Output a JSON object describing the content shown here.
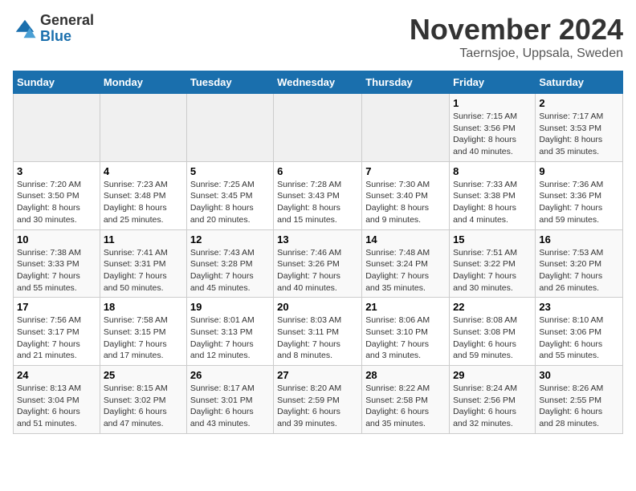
{
  "logo": {
    "general": "General",
    "blue": "Blue"
  },
  "title": "November 2024",
  "subtitle": "Taernsjoe, Uppsala, Sweden",
  "days_of_week": [
    "Sunday",
    "Monday",
    "Tuesday",
    "Wednesday",
    "Thursday",
    "Friday",
    "Saturday"
  ],
  "weeks": [
    [
      {
        "day": "",
        "info": ""
      },
      {
        "day": "",
        "info": ""
      },
      {
        "day": "",
        "info": ""
      },
      {
        "day": "",
        "info": ""
      },
      {
        "day": "",
        "info": ""
      },
      {
        "day": "1",
        "info": "Sunrise: 7:15 AM\nSunset: 3:56 PM\nDaylight: 8 hours\nand 40 minutes."
      },
      {
        "day": "2",
        "info": "Sunrise: 7:17 AM\nSunset: 3:53 PM\nDaylight: 8 hours\nand 35 minutes."
      }
    ],
    [
      {
        "day": "3",
        "info": "Sunrise: 7:20 AM\nSunset: 3:50 PM\nDaylight: 8 hours\nand 30 minutes."
      },
      {
        "day": "4",
        "info": "Sunrise: 7:23 AM\nSunset: 3:48 PM\nDaylight: 8 hours\nand 25 minutes."
      },
      {
        "day": "5",
        "info": "Sunrise: 7:25 AM\nSunset: 3:45 PM\nDaylight: 8 hours\nand 20 minutes."
      },
      {
        "day": "6",
        "info": "Sunrise: 7:28 AM\nSunset: 3:43 PM\nDaylight: 8 hours\nand 15 minutes."
      },
      {
        "day": "7",
        "info": "Sunrise: 7:30 AM\nSunset: 3:40 PM\nDaylight: 8 hours\nand 9 minutes."
      },
      {
        "day": "8",
        "info": "Sunrise: 7:33 AM\nSunset: 3:38 PM\nDaylight: 8 hours\nand 4 minutes."
      },
      {
        "day": "9",
        "info": "Sunrise: 7:36 AM\nSunset: 3:36 PM\nDaylight: 7 hours\nand 59 minutes."
      }
    ],
    [
      {
        "day": "10",
        "info": "Sunrise: 7:38 AM\nSunset: 3:33 PM\nDaylight: 7 hours\nand 55 minutes."
      },
      {
        "day": "11",
        "info": "Sunrise: 7:41 AM\nSunset: 3:31 PM\nDaylight: 7 hours\nand 50 minutes."
      },
      {
        "day": "12",
        "info": "Sunrise: 7:43 AM\nSunset: 3:28 PM\nDaylight: 7 hours\nand 45 minutes."
      },
      {
        "day": "13",
        "info": "Sunrise: 7:46 AM\nSunset: 3:26 PM\nDaylight: 7 hours\nand 40 minutes."
      },
      {
        "day": "14",
        "info": "Sunrise: 7:48 AM\nSunset: 3:24 PM\nDaylight: 7 hours\nand 35 minutes."
      },
      {
        "day": "15",
        "info": "Sunrise: 7:51 AM\nSunset: 3:22 PM\nDaylight: 7 hours\nand 30 minutes."
      },
      {
        "day": "16",
        "info": "Sunrise: 7:53 AM\nSunset: 3:20 PM\nDaylight: 7 hours\nand 26 minutes."
      }
    ],
    [
      {
        "day": "17",
        "info": "Sunrise: 7:56 AM\nSunset: 3:17 PM\nDaylight: 7 hours\nand 21 minutes."
      },
      {
        "day": "18",
        "info": "Sunrise: 7:58 AM\nSunset: 3:15 PM\nDaylight: 7 hours\nand 17 minutes."
      },
      {
        "day": "19",
        "info": "Sunrise: 8:01 AM\nSunset: 3:13 PM\nDaylight: 7 hours\nand 12 minutes."
      },
      {
        "day": "20",
        "info": "Sunrise: 8:03 AM\nSunset: 3:11 PM\nDaylight: 7 hours\nand 8 minutes."
      },
      {
        "day": "21",
        "info": "Sunrise: 8:06 AM\nSunset: 3:10 PM\nDaylight: 7 hours\nand 3 minutes."
      },
      {
        "day": "22",
        "info": "Sunrise: 8:08 AM\nSunset: 3:08 PM\nDaylight: 6 hours\nand 59 minutes."
      },
      {
        "day": "23",
        "info": "Sunrise: 8:10 AM\nSunset: 3:06 PM\nDaylight: 6 hours\nand 55 minutes."
      }
    ],
    [
      {
        "day": "24",
        "info": "Sunrise: 8:13 AM\nSunset: 3:04 PM\nDaylight: 6 hours\nand 51 minutes."
      },
      {
        "day": "25",
        "info": "Sunrise: 8:15 AM\nSunset: 3:02 PM\nDaylight: 6 hours\nand 47 minutes."
      },
      {
        "day": "26",
        "info": "Sunrise: 8:17 AM\nSunset: 3:01 PM\nDaylight: 6 hours\nand 43 minutes."
      },
      {
        "day": "27",
        "info": "Sunrise: 8:20 AM\nSunset: 2:59 PM\nDaylight: 6 hours\nand 39 minutes."
      },
      {
        "day": "28",
        "info": "Sunrise: 8:22 AM\nSunset: 2:58 PM\nDaylight: 6 hours\nand 35 minutes."
      },
      {
        "day": "29",
        "info": "Sunrise: 8:24 AM\nSunset: 2:56 PM\nDaylight: 6 hours\nand 32 minutes."
      },
      {
        "day": "30",
        "info": "Sunrise: 8:26 AM\nSunset: 2:55 PM\nDaylight: 6 hours\nand 28 minutes."
      }
    ]
  ]
}
